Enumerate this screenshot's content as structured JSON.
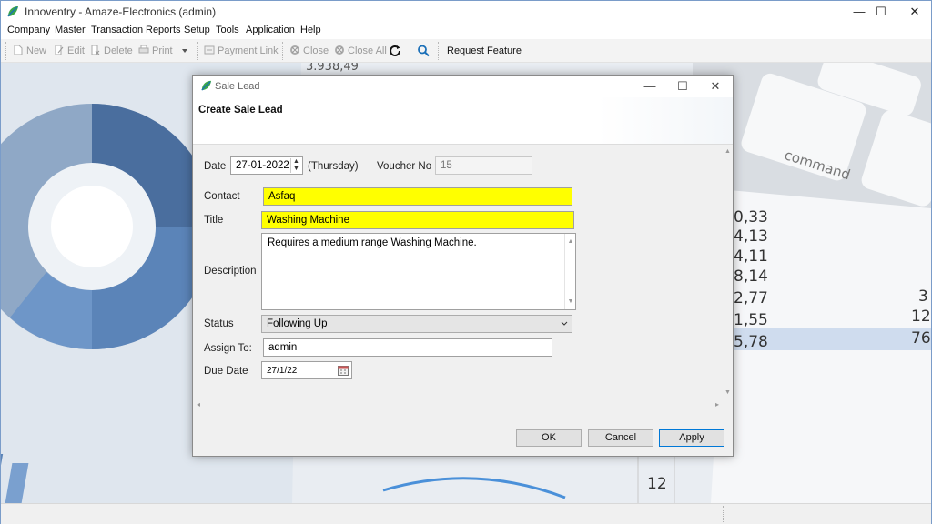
{
  "app": {
    "title": "Innoventry - Amaze-Electronics (admin)",
    "window_controls": {
      "minimize": "—",
      "maximize": "☐",
      "close": "✕"
    }
  },
  "menu": [
    "Company",
    "Master",
    "Transaction",
    "Reports",
    "Setup",
    "Tools",
    "Application",
    "Help"
  ],
  "toolbar": {
    "new": "New",
    "edit": "Edit",
    "delete": "Delete",
    "print": "Print",
    "payment_link": "Payment Link",
    "close": "Close",
    "close_all": "Close All",
    "request_feature": "Request Feature"
  },
  "background_numbers": [
    "3.938,49",
    "0,33",
    "4,13",
    "4,11",
    "8,14",
    "2,77",
    "1,55",
    "5,78",
    "3",
    "12",
    "76",
    "12"
  ],
  "background_key_label": "command",
  "dialog": {
    "title": "Sale Lead",
    "header": "Create Sale Lead",
    "date_label": "Date",
    "date_value": "27-01-2022",
    "weekday": "(Thursday)",
    "voucher_label": "Voucher No",
    "voucher_value": "15",
    "contact_label": "Contact",
    "contact_value": "Asfaq",
    "title_label": "Title",
    "title_value": "Washing Machine",
    "description_label": "Description",
    "description_value": "Requires a medium range Washing Machine.",
    "status_label": "Status",
    "status_value": "Following Up",
    "assign_label": "Assign To:",
    "assign_value": "admin",
    "due_label": "Due Date",
    "due_value": "27/1/22",
    "buttons": {
      "ok": "OK",
      "cancel": "Cancel",
      "apply": "Apply"
    }
  },
  "colors": {
    "highlight_yellow": "#ffff00",
    "accent_blue": "#0078d7"
  }
}
